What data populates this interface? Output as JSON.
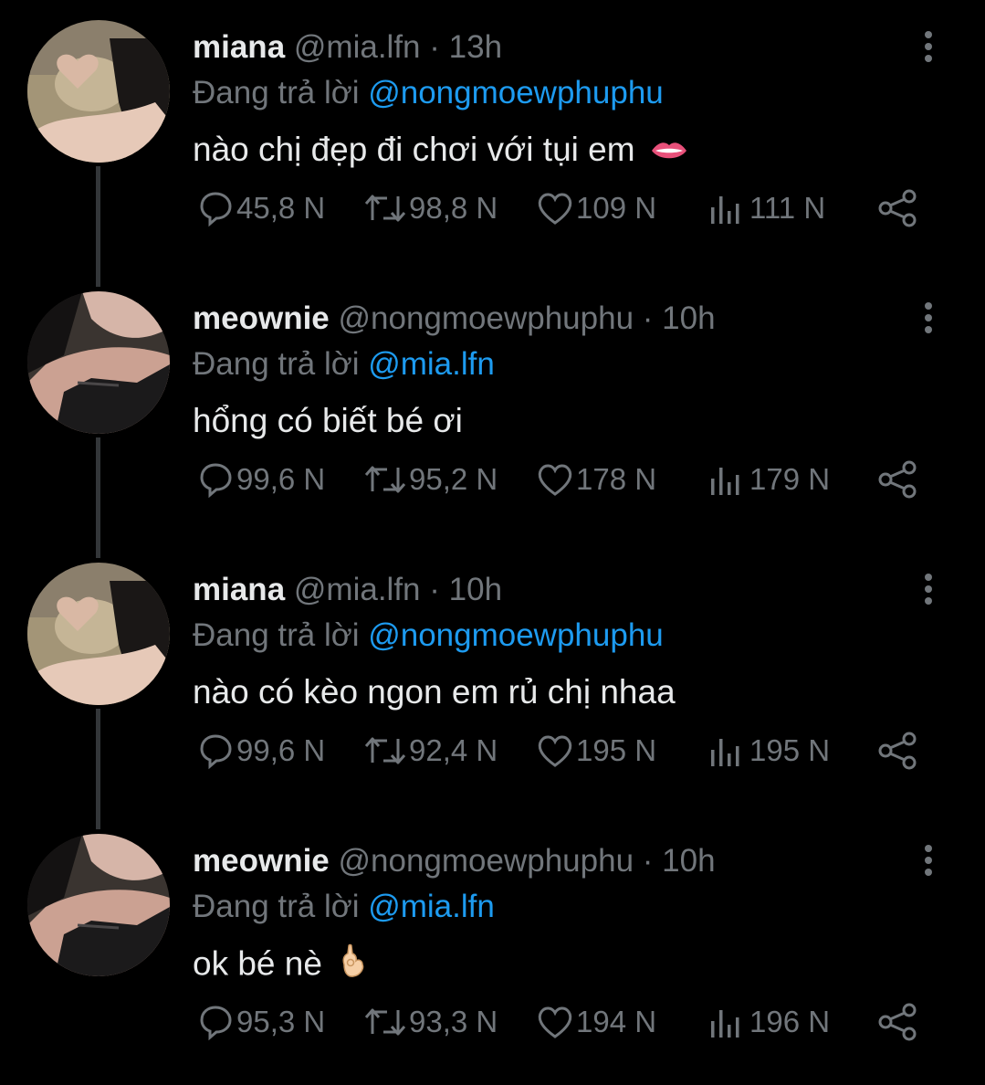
{
  "reply_prefix": "Đang trả lời",
  "tweets": [
    {
      "name": "miana",
      "handle": "@mia.lfn",
      "dot": "·",
      "time": "13h",
      "reply_to": "@nongmoewphuphu",
      "text": "nào chị đẹp đi chơi với tụi em",
      "emoji": "lips-icon",
      "stats": {
        "replies": "45,8 N",
        "retweets": "98,8 N",
        "likes": "109 N",
        "views": "111 N"
      }
    },
    {
      "name": "meownie",
      "handle": "@nongmoewphuphu",
      "dot": "·",
      "time": "10h",
      "reply_to": "@mia.lfn",
      "text": "hổng có biết bé ơi",
      "emoji": "",
      "stats": {
        "replies": "99,6 N",
        "retweets": "95,2 N",
        "likes": "178 N",
        "views": "179 N"
      }
    },
    {
      "name": "miana",
      "handle": "@mia.lfn",
      "dot": "·",
      "time": "10h",
      "reply_to": "@nongmoewphuphu",
      "text": "nào có kèo ngon em rủ chị nhaa",
      "emoji": "",
      "stats": {
        "replies": "99,6 N",
        "retweets": "92,4 N",
        "likes": "195 N",
        "views": "195 N"
      }
    },
    {
      "name": "meownie",
      "handle": "@nongmoewphuphu",
      "dot": "·",
      "time": "10h",
      "reply_to": "@mia.lfn",
      "text": "ok bé nè",
      "emoji": "ok-hand-icon",
      "stats": {
        "replies": "95,3 N",
        "retweets": "93,3 N",
        "likes": "194 N",
        "views": "196 N"
      }
    }
  ],
  "colors": {
    "background": "#000000",
    "primary_text": "#e7e9ea",
    "secondary_text": "#71767b",
    "mention": "#1d9bf0",
    "thread_line": "#333639"
  }
}
